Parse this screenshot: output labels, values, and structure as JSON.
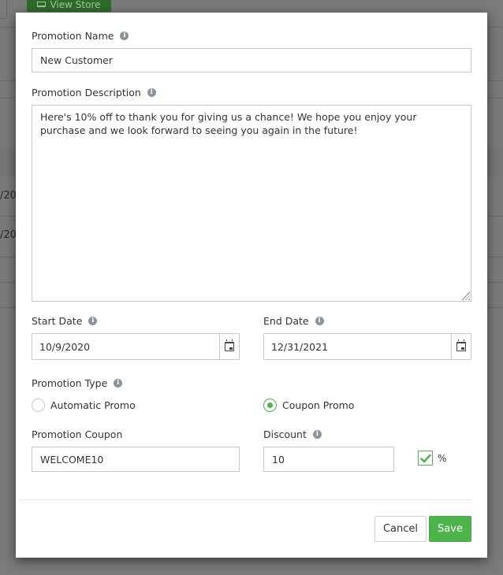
{
  "background": {
    "view_store_label": "View Store",
    "partial_dates": [
      "/20",
      "/20"
    ]
  },
  "modal": {
    "promotion_name": {
      "label": "Promotion Name",
      "value": "New Customer"
    },
    "promotion_description": {
      "label": "Promotion Description",
      "value": "Here's 10% off to thank you for giving us a chance! We hope you enjoy your purchase and we look forward to seeing you again in the future!"
    },
    "start_date": {
      "label": "Start Date",
      "value": "10/9/2020"
    },
    "end_date": {
      "label": "End Date",
      "value": "12/31/2021"
    },
    "promotion_type": {
      "label": "Promotion Type",
      "options": [
        {
          "label": "Automatic Promo",
          "selected": false
        },
        {
          "label": "Coupon Promo",
          "selected": true
        }
      ]
    },
    "promotion_coupon": {
      "label": "Promotion Coupon",
      "value": "WELCOME10"
    },
    "discount": {
      "label": "Discount",
      "value": "10",
      "percent_label": "%",
      "percent_checked": true
    },
    "buttons": {
      "cancel": "Cancel",
      "save": "Save"
    }
  },
  "colors": {
    "accent": "#4db34b",
    "overlay": "#7b7b7b",
    "info_icon": "#8a939c"
  }
}
